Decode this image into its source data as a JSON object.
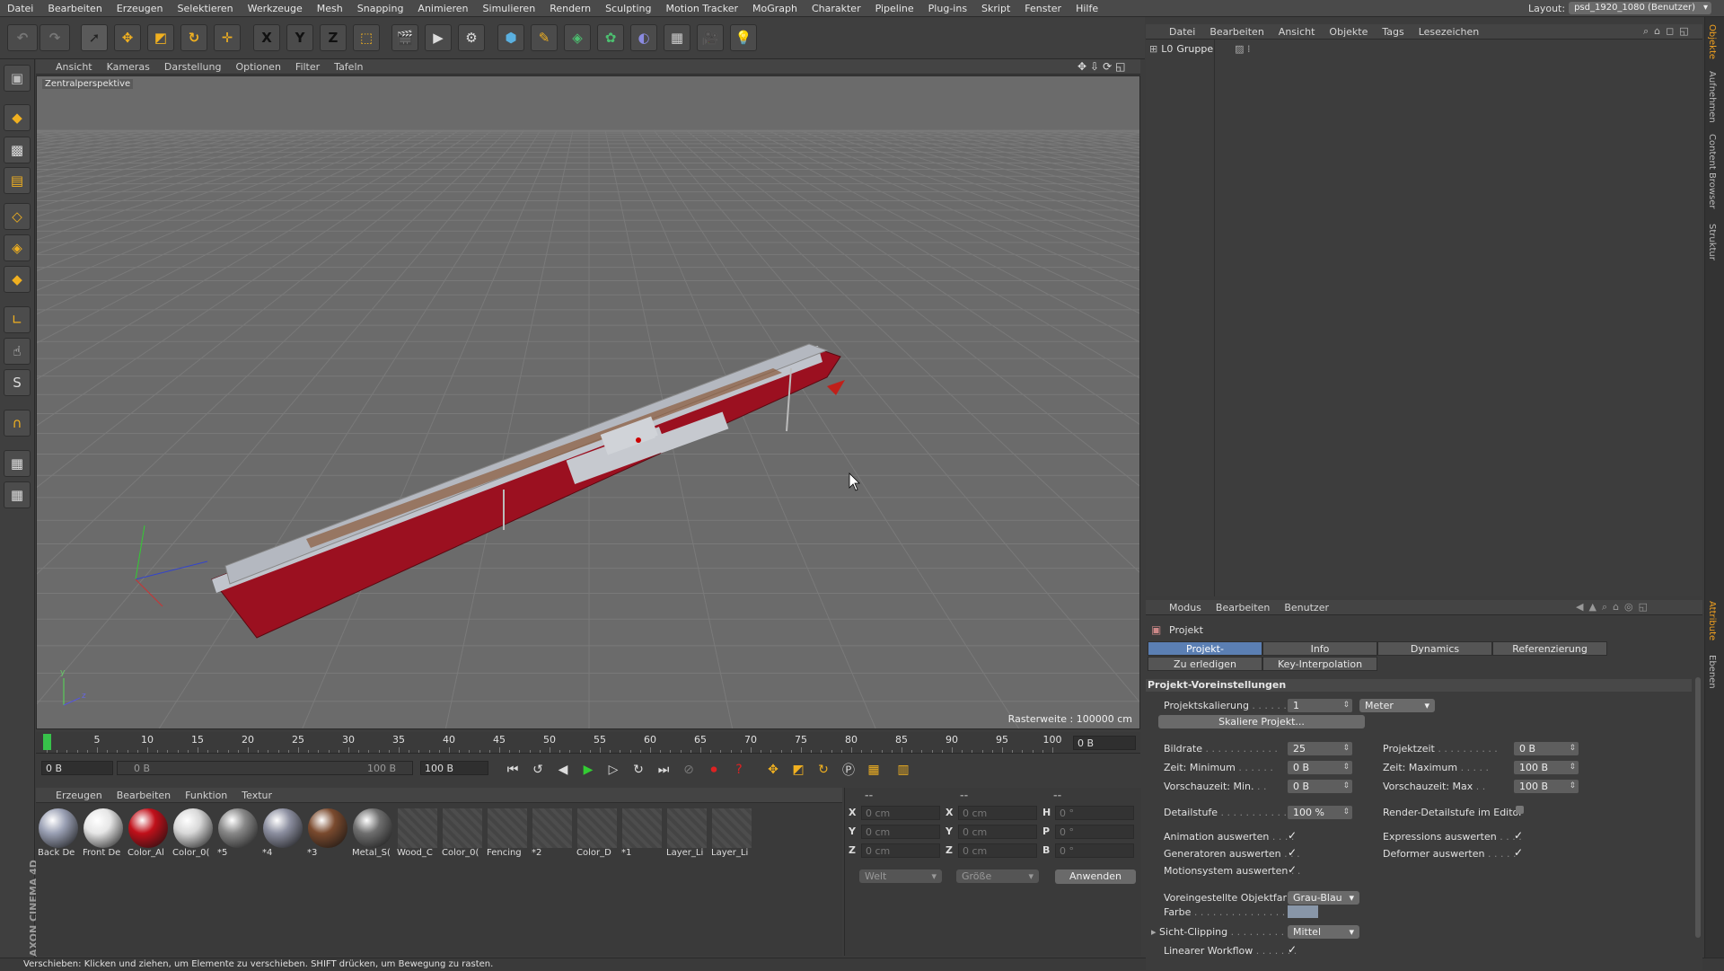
{
  "menubar": {
    "items": [
      "Datei",
      "Bearbeiten",
      "Erzeugen",
      "Selektieren",
      "Werkzeuge",
      "Mesh",
      "Snapping",
      "Animieren",
      "Simulieren",
      "Rendern",
      "Sculpting",
      "Motion Tracker",
      "MoGraph",
      "Charakter",
      "Pipeline",
      "Plug-ins",
      "Skript",
      "Fenster",
      "Hilfe"
    ],
    "layout_label": "Layout:",
    "layout_value": "psd_1920_1080 (Benutzer)"
  },
  "toolbar": {
    "icons": [
      "undo-icon",
      "redo-icon",
      "select-arrow-icon",
      "move-icon",
      "scale-icon",
      "rotate-icon",
      "add-icon",
      "x-axis-icon",
      "y-axis-icon",
      "z-axis-icon",
      "coordinate-system-icon",
      "render-view-icon",
      "render-picture-viewer-icon",
      "edit-render-settings-icon",
      "cube-icon",
      "pen-icon",
      "subdivision-icon",
      "cloner-icon",
      "deformer-icon",
      "floor-icon",
      "camera-icon",
      "light-icon"
    ],
    "axis_labels": [
      "X",
      "Y",
      "Z"
    ]
  },
  "left_tools": [
    "make-editable-icon",
    "model-mode-icon",
    "texture-mode-icon",
    "workplane-icon",
    "points-mode-icon",
    "edges-mode-icon",
    "polygons-mode-icon",
    "axis-mode-icon",
    "tweak-mode-icon",
    "snap-icon",
    "magnet-icon",
    "grid-lock-icon",
    "locked-workplane-icon"
  ],
  "viewport": {
    "menu": [
      "Ansicht",
      "Kameras",
      "Darstellung",
      "Optionen",
      "Filter",
      "Tafeln"
    ],
    "camera_label": "Zentralperspektive",
    "raster_label": "Rasterweite : 100000 cm",
    "hull_color": "#c0c4cc",
    "keel_color": "#9b1020",
    "background_color": "#6b6b6b"
  },
  "timeline": {
    "ticks": [
      "0",
      "5",
      "10",
      "15",
      "20",
      "25",
      "30",
      "35",
      "40",
      "45",
      "50",
      "55",
      "60",
      "65",
      "70",
      "75",
      "80",
      "85",
      "90",
      "95",
      "100"
    ],
    "current_frame": "0 B",
    "start_field": "0 B",
    "range_start": "0 B",
    "range_end": "100 B",
    "end_field": "100 B"
  },
  "materials": {
    "menu": [
      "Erzeugen",
      "Bearbeiten",
      "Funktion",
      "Textur"
    ],
    "items": [
      {
        "label": "Back De",
        "type": "ball",
        "color": "#9aa0b4"
      },
      {
        "label": "Front De",
        "type": "ball",
        "color": "#e6e6e6"
      },
      {
        "label": "Color_Al",
        "type": "ball",
        "color": "#c0101a"
      },
      {
        "label": "Color_0(",
        "type": "ball",
        "color": "#d8d8d8"
      },
      {
        "label": "*5",
        "type": "ball",
        "color": "#888888"
      },
      {
        "label": "*4",
        "type": "ball",
        "color": "#8c8fa0"
      },
      {
        "label": "*3",
        "type": "ball",
        "color": "#7a4a2e"
      },
      {
        "label": "Metal_S(",
        "type": "ball",
        "color": "#6f6f6f"
      },
      {
        "label": "Wood_C",
        "type": "sq",
        "color": ""
      },
      {
        "label": "Color_0(",
        "type": "sq",
        "color": ""
      },
      {
        "label": "Fencing",
        "type": "sq",
        "color": ""
      },
      {
        "label": "*2",
        "type": "sq",
        "color": ""
      },
      {
        "label": "Color_D",
        "type": "sq",
        "color": ""
      },
      {
        "label": "*1",
        "type": "sq",
        "color": ""
      },
      {
        "label": "Layer_Li",
        "type": "sq",
        "color": ""
      },
      {
        "label": "Layer_Li",
        "type": "sq",
        "color": ""
      }
    ]
  },
  "coordinates": {
    "headers": [
      "--",
      "--",
      "--"
    ],
    "rows": [
      {
        "a": "X",
        "av": "0 cm",
        "b": "X",
        "bv": "0 cm",
        "c": "H",
        "cv": "0 °"
      },
      {
        "a": "Y",
        "av": "0 cm",
        "b": "Y",
        "bv": "0 cm",
        "c": "P",
        "cv": "0 °"
      },
      {
        "a": "Z",
        "av": "0 cm",
        "b": "Z",
        "bv": "0 cm",
        "c": "B",
        "cv": "0 °"
      }
    ],
    "mode1": "Welt",
    "mode2": "Größe",
    "apply": "Anwenden"
  },
  "objects": {
    "menu": [
      "Datei",
      "Bearbeiten",
      "Ansicht",
      "Objekte",
      "Tags",
      "Lesezeichen"
    ],
    "tree": [
      {
        "label": "Gruppe",
        "prefix": "L0"
      }
    ]
  },
  "attributes": {
    "menu": [
      "Modus",
      "Bearbeiten",
      "Benutzer"
    ],
    "title": "Projekt",
    "tabs_row1": [
      "Projekt-Voreinstellungen",
      "Info",
      "Dynamics",
      "Referenzierung"
    ],
    "tabs_row2": [
      "Zu erledigen",
      "Key-Interpolation"
    ],
    "section": "Projekt-Voreinstellungen",
    "projektskalierung_label": "Projektskalierung",
    "projektskalierung_value": "1",
    "projektskalierung_unit": "Meter",
    "skaliere_button": "Skaliere Projekt...",
    "bildrate_label": "Bildrate",
    "bildrate_value": "25",
    "projektzeit_label": "Projektzeit",
    "projektzeit_value": "0 B",
    "zeit_min_label": "Zeit: Minimum",
    "zeit_min_value": "0 B",
    "zeit_max_label": "Zeit: Maximum",
    "zeit_max_value": "100 B",
    "vorschau_min_label": "Vorschauzeit: Min.",
    "vorschau_min_value": "0 B",
    "vorschau_max_label": "Vorschauzeit: Max",
    "vorschau_max_value": "100 B",
    "detailstufe_label": "Detailstufe",
    "detailstufe_value": "100 %",
    "render_detail_label": "Render-Detailstufe im Editor",
    "anim_label": "Animation auswerten",
    "expr_label": "Expressions auswerten",
    "gen_label": "Generatoren auswerten",
    "deform_label": "Deformer auswerten",
    "motion_label": "Motionsystem auswerten",
    "objfarbe_label": "Voreingestellte Objektfarbe",
    "objfarbe_value": "Grau-Blau",
    "farbe_label": "Farbe",
    "clipping_label": "Sicht-Clipping",
    "clipping_value": "Mittel",
    "linear_label": "Linearer Workflow"
  },
  "right_strip": [
    "Objekte",
    "Aufnehmen",
    "Content Browser",
    "Struktur",
    "Attribute",
    "Ebenen"
  ],
  "status": "Verschieben: Klicken und ziehen, um Elemente zu verschieben. SHIFT drücken, um Bewegung zu rasten.",
  "brand": "MAXON CINEMA 4D"
}
